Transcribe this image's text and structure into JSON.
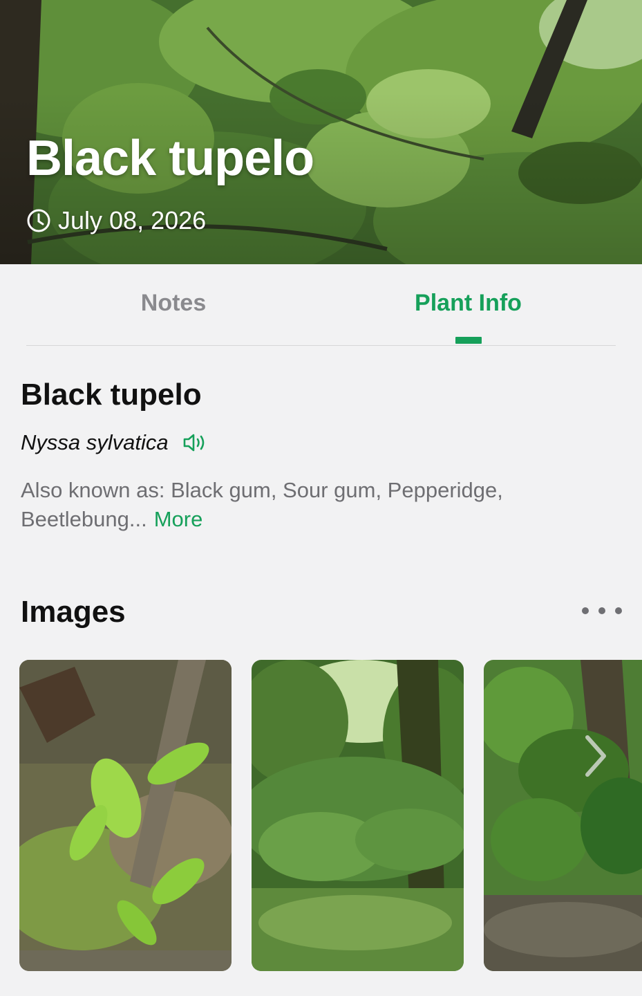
{
  "hero": {
    "title": "Black tupelo",
    "date": "July 08, 2026",
    "icon": "clock-icon"
  },
  "tabs": [
    {
      "label": "Notes",
      "active": false
    },
    {
      "label": "Plant Info",
      "active": true
    }
  ],
  "plant": {
    "common_name": "Black tupelo",
    "scientific_name": "Nyssa sylvatica",
    "audio_icon": "speaker-icon",
    "also_known_as": "Also known as: Black gum, Sour gum, Pepperidge, Beetlebung...",
    "more_label": "More"
  },
  "images_section": {
    "title": "Images",
    "menu_icon": "more-dots-icon",
    "next_icon": "chevron-right-icon",
    "thumbnails": 3
  },
  "colors": {
    "accent": "#16a05a",
    "background": "#f2f2f3",
    "inactive_tab": "#8a8a8e",
    "secondary_text": "#6e6e72"
  }
}
